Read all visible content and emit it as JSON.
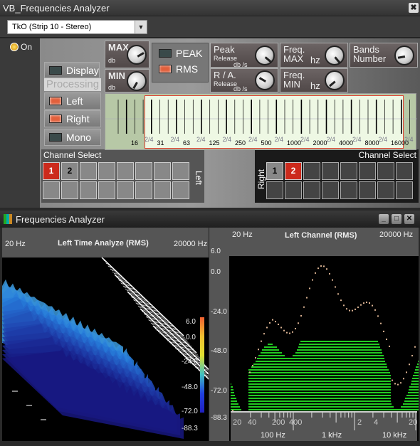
{
  "window1": {
    "title": "VB_Frequencies Analyzer",
    "close": "✖",
    "dropdown": {
      "value": "TkO (Strip 10 - Stereo)",
      "arrow": "▼"
    },
    "power": {
      "label": "On"
    },
    "display_label": "Display",
    "processing_label": "Processing",
    "channels_mode": [
      {
        "label": "Left",
        "active": true
      },
      {
        "label": "Right",
        "active": true
      },
      {
        "label": "Mono",
        "active": false
      }
    ],
    "max_knob": {
      "title": "MAX",
      "unit": "db"
    },
    "min_knob": {
      "title": "MIN",
      "unit": "db"
    },
    "mode": [
      {
        "label": "PEAK",
        "active": false
      },
      {
        "label": "RMS",
        "active": true
      }
    ],
    "peak_release": {
      "title": "Peak",
      "sub": "Release",
      "unit": "db /s"
    },
    "ra_release": {
      "title": "R / A.",
      "sub": "Release",
      "unit": "db /s"
    },
    "freq_max": {
      "title": "Freq.",
      "sub": "MAX",
      "unit": "hz"
    },
    "freq_min": {
      "title": "Freq.",
      "sub": "MIN",
      "unit": "hz"
    },
    "bands": {
      "title": "Bands",
      "sub": "Number"
    },
    "freq_labels": [
      "16",
      "31",
      "63",
      "125",
      "250",
      "500",
      "1000",
      "2000",
      "4000",
      "8000",
      "16000"
    ],
    "band_label": "2/4",
    "left_select": {
      "title": "Channel Select",
      "side": "Left",
      "buttons": [
        "1",
        "2"
      ]
    },
    "right_select": {
      "title": "Channel Select",
      "side": "Right",
      "buttons": [
        "1",
        "2"
      ]
    }
  },
  "window2": {
    "title": "Frequencies Analyzer",
    "min": "_",
    "max": "□",
    "close": "✕",
    "left_panel": {
      "lo": "20 Hz",
      "title": "Left Time Analyze (RMS)",
      "hi": "20000 Hz",
      "scale": [
        "6.0",
        "0.0",
        "-24.0",
        "-48.0",
        "-72.0",
        "-88.3"
      ]
    },
    "mid_scale": [
      "6.0",
      "0.0",
      "-24.0",
      "-48.0",
      "-72.0",
      "-88.3"
    ],
    "right_panel": {
      "lo": "20 Hz",
      "title": "Left Channel (RMS)",
      "hi": "20000 Hz",
      "axis_minor": [
        "20",
        "40",
        "200",
        "400",
        "2",
        "4",
        "20"
      ],
      "axis_major": [
        "100 Hz",
        "1 kHz",
        "10 kHz"
      ]
    },
    "colors": {
      "spectrum": "#22cc22",
      "peak": "#d8b090"
    }
  }
}
